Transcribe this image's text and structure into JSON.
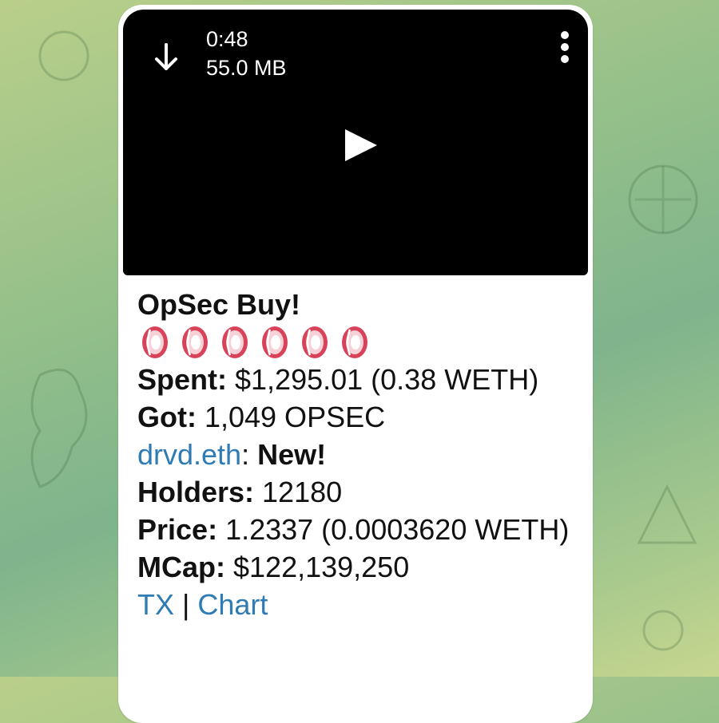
{
  "video": {
    "duration": "0:48",
    "size": "55.0 MB",
    "icons": [
      "download-icon",
      "more-menu-icon",
      "play-icon"
    ]
  },
  "message": {
    "title": "OpSec Buy!",
    "emoji_count": 6,
    "emoji_name": "lifebuoy-ring-emoji",
    "spent_label": "Spent:",
    "spent_value": " $1,295.01 (0.38 WETH)",
    "got_label": "Got:",
    "got_value": " 1,049 OPSEC",
    "buyer_link": "drvd.eth",
    "buyer_sep": ": ",
    "buyer_status": "New!",
    "holders_label": "Holders:",
    "holders_value": " 12180",
    "price_label": "Price:",
    "price_value": " 1.2337 (0.0003620 WETH)",
    "mcap_label": "MCap:",
    "mcap_value": " $122,139,250",
    "tx_link": "TX",
    "links_sep": " | ",
    "chart_link": "Chart"
  },
  "colors": {
    "link": "#2f7bb4",
    "bubble": "#ffffff",
    "video": "#000000",
    "emoji_ring": "#d8435a"
  }
}
